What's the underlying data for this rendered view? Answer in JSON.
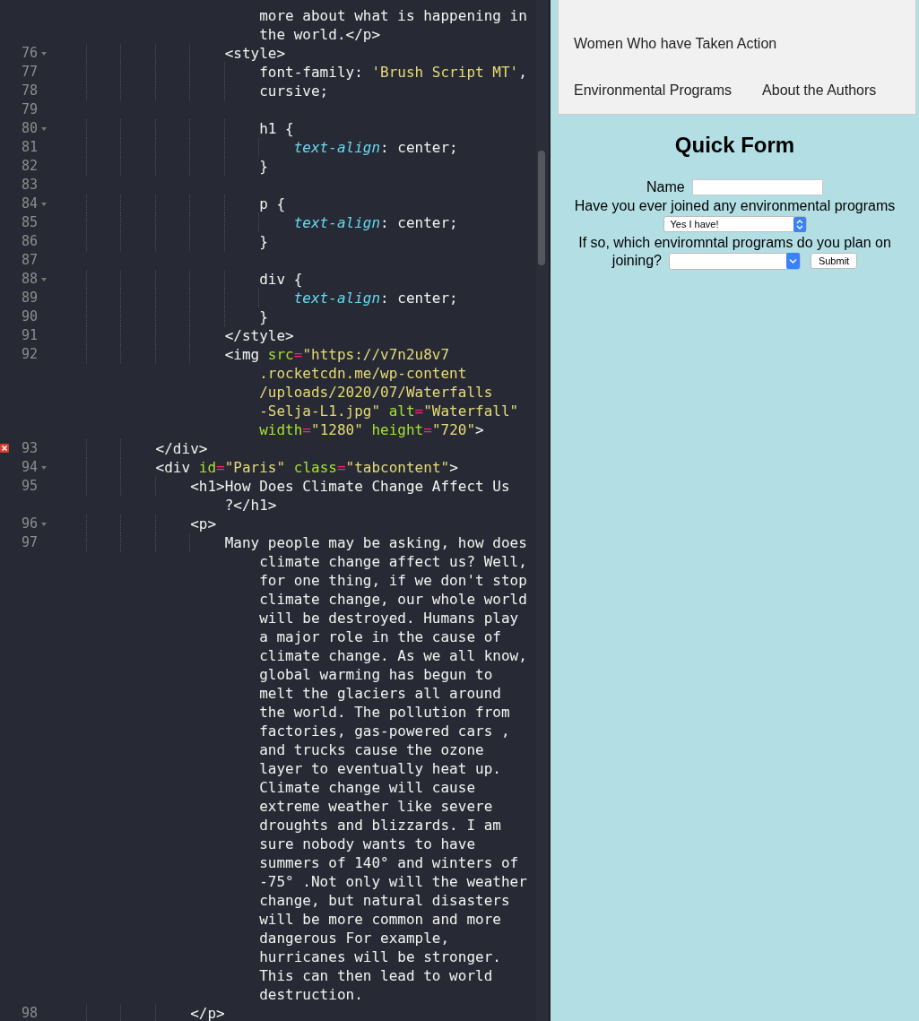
{
  "editor": {
    "lines": [
      {
        "rows": [
          {
            "segments": [
              {
                "kind": "plain",
                "text": "                        more about what is happening in"
              }
            ]
          },
          {
            "segments": [
              {
                "kind": "plain",
                "text": "                        the world.</p>"
              }
            ]
          }
        ]
      },
      {
        "number": "76",
        "fold": true,
        "rows": [
          {
            "segments": [
              {
                "kind": "plain",
                "text": "                    <style>"
              }
            ]
          }
        ]
      },
      {
        "number": "77",
        "rows": [
          {
            "segments": [
              {
                "kind": "plain",
                "text": "                        font-family: "
              },
              {
                "kind": "string",
                "text": "'Brush Script MT'"
              },
              {
                "kind": "plain",
                "text": ","
              }
            ]
          }
        ]
      },
      {
        "number": "78",
        "rows": [
          {
            "segments": [
              {
                "kind": "plain",
                "text": "                        cursive;"
              }
            ]
          }
        ]
      },
      {
        "number": "79"
      },
      {
        "number": "80",
        "fold": true,
        "rows": [
          {
            "segments": [
              {
                "kind": "plain",
                "text": "                        h1 {"
              }
            ]
          }
        ]
      },
      {
        "number": "81",
        "rows": [
          {
            "segments": [
              {
                "kind": "prop",
                "text": "                            text-align"
              },
              {
                "kind": "plain",
                "text": ": center;"
              }
            ]
          }
        ]
      },
      {
        "number": "82",
        "rows": [
          {
            "segments": [
              {
                "kind": "plain",
                "text": "                        }"
              }
            ]
          }
        ]
      },
      {
        "number": "83"
      },
      {
        "number": "84",
        "fold": true,
        "rows": [
          {
            "segments": [
              {
                "kind": "plain",
                "text": "                        p {"
              }
            ]
          }
        ]
      },
      {
        "number": "85",
        "rows": [
          {
            "segments": [
              {
                "kind": "prop",
                "text": "                            text-align"
              },
              {
                "kind": "plain",
                "text": ": center;"
              }
            ]
          }
        ]
      },
      {
        "number": "86",
        "rows": [
          {
            "segments": [
              {
                "kind": "plain",
                "text": "                        }"
              }
            ]
          }
        ]
      },
      {
        "number": "87"
      },
      {
        "number": "88",
        "fold": true,
        "rows": [
          {
            "segments": [
              {
                "kind": "plain",
                "text": "                        div {"
              }
            ]
          }
        ]
      },
      {
        "number": "89",
        "rows": [
          {
            "segments": [
              {
                "kind": "prop",
                "text": "                            text-align"
              },
              {
                "kind": "plain",
                "text": ": center;"
              }
            ]
          }
        ]
      },
      {
        "number": "90",
        "rows": [
          {
            "segments": [
              {
                "kind": "plain",
                "text": "                        }"
              }
            ]
          }
        ]
      },
      {
        "number": "91",
        "rows": [
          {
            "segments": [
              {
                "kind": "plain",
                "text": "                    </style>"
              }
            ]
          }
        ]
      },
      {
        "number": "92",
        "rows": [
          {
            "segments": [
              {
                "kind": "plain",
                "text": "                    <img "
              },
              {
                "kind": "attr",
                "text": "src"
              },
              {
                "kind": "op",
                "text": "="
              },
              {
                "kind": "string",
                "text": "\"https://v7n2u8v7"
              }
            ]
          },
          {
            "segments": [
              {
                "kind": "string",
                "text": "                        .rocketcdn.me/wp-content"
              }
            ]
          },
          {
            "segments": [
              {
                "kind": "string",
                "text": "                        /uploads/2020/07/Waterfalls"
              }
            ]
          },
          {
            "segments": [
              {
                "kind": "string",
                "text": "                        -Selja-L1.jpg\""
              },
              {
                "kind": "attr",
                "text": " alt"
              },
              {
                "kind": "op",
                "text": "="
              },
              {
                "kind": "string",
                "text": "\"Waterfall\""
              }
            ]
          },
          {
            "segments": [
              {
                "kind": "attr",
                "text": "                        width"
              },
              {
                "kind": "op",
                "text": "="
              },
              {
                "kind": "string",
                "text": "\"1280\""
              },
              {
                "kind": "attr",
                "text": " height"
              },
              {
                "kind": "op",
                "text": "="
              },
              {
                "kind": "string",
                "text": "\"720\""
              },
              {
                "kind": "plain",
                "text": ">"
              }
            ]
          }
        ]
      },
      {
        "number": "93",
        "error": true,
        "rows": [
          {
            "segments": [
              {
                "kind": "plain",
                "text": "            </div>"
              }
            ]
          }
        ]
      },
      {
        "number": "94",
        "fold": true,
        "rows": [
          {
            "segments": [
              {
                "kind": "plain",
                "text": "            <div "
              },
              {
                "kind": "attr",
                "text": "id"
              },
              {
                "kind": "op",
                "text": "="
              },
              {
                "kind": "string",
                "text": "\"Paris\""
              },
              {
                "kind": "attr",
                "text": " class"
              },
              {
                "kind": "op",
                "text": "="
              },
              {
                "kind": "string",
                "text": "\"tabcontent\""
              },
              {
                "kind": "plain",
                "text": ">"
              }
            ]
          }
        ]
      },
      {
        "number": "95",
        "rows": [
          {
            "segments": [
              {
                "kind": "plain",
                "text": "                <h1>How Does Climate Change Affect Us"
              }
            ]
          },
          {
            "segments": [
              {
                "kind": "plain",
                "text": "                    ?</h1>"
              }
            ]
          }
        ]
      },
      {
        "number": "96",
        "fold": true,
        "rows": [
          {
            "segments": [
              {
                "kind": "plain",
                "text": "                <p>"
              }
            ]
          }
        ]
      },
      {
        "number": "97",
        "rows": [
          {
            "segments": [
              {
                "kind": "plain",
                "text": "                    Many people may be asking, how does"
              }
            ]
          },
          {
            "segments": [
              {
                "kind": "plain",
                "text": "                        climate change affect us? Well,"
              }
            ]
          },
          {
            "segments": [
              {
                "kind": "plain",
                "text": "                        for one thing, if we don't stop"
              }
            ]
          },
          {
            "segments": [
              {
                "kind": "plain",
                "text": "                        climate change, our whole world"
              }
            ]
          },
          {
            "segments": [
              {
                "kind": "plain",
                "text": "                        will be destroyed. Humans play"
              }
            ]
          },
          {
            "segments": [
              {
                "kind": "plain",
                "text": "                        a major role in the cause of"
              }
            ]
          },
          {
            "segments": [
              {
                "kind": "plain",
                "text": "                        climate change. As we all know,"
              }
            ]
          },
          {
            "segments": [
              {
                "kind": "plain",
                "text": "                        global warming has begun to"
              }
            ]
          },
          {
            "segments": [
              {
                "kind": "plain",
                "text": "                        melt the glaciers all around"
              }
            ]
          },
          {
            "segments": [
              {
                "kind": "plain",
                "text": "                        the world. The pollution from"
              }
            ]
          },
          {
            "segments": [
              {
                "kind": "plain",
                "text": "                        factories, gas-powered cars ,"
              }
            ]
          },
          {
            "segments": [
              {
                "kind": "plain",
                "text": "                        and trucks cause the ozone"
              }
            ]
          },
          {
            "segments": [
              {
                "kind": "plain",
                "text": "                        layer to eventually heat up."
              }
            ]
          },
          {
            "segments": [
              {
                "kind": "plain",
                "text": "                        Climate change will cause"
              }
            ]
          },
          {
            "segments": [
              {
                "kind": "plain",
                "text": "                        extreme weather like severe"
              }
            ]
          },
          {
            "segments": [
              {
                "kind": "plain",
                "text": "                        droughts and blizzards. I am"
              }
            ]
          },
          {
            "segments": [
              {
                "kind": "plain",
                "text": "                        sure nobody wants to have"
              }
            ]
          },
          {
            "segments": [
              {
                "kind": "plain",
                "text": "                        summers of 140° and winters of"
              }
            ]
          },
          {
            "segments": [
              {
                "kind": "plain",
                "text": "                        -75° .Not only will the weather"
              }
            ]
          },
          {
            "segments": [
              {
                "kind": "plain",
                "text": "                        change, but natural disasters"
              }
            ]
          },
          {
            "segments": [
              {
                "kind": "plain",
                "text": "                        will be more common and more"
              }
            ]
          },
          {
            "segments": [
              {
                "kind": "plain",
                "text": "                        dangerous For example,"
              }
            ]
          },
          {
            "segments": [
              {
                "kind": "plain",
                "text": "                        hurricanes will be stronger."
              }
            ]
          },
          {
            "segments": [
              {
                "kind": "plain",
                "text": "                        This can then lead to world"
              }
            ]
          },
          {
            "segments": [
              {
                "kind": "plain",
                "text": "                        destruction."
              }
            ]
          }
        ]
      },
      {
        "number": "98",
        "rows": [
          {
            "segments": [
              {
                "kind": "plain",
                "text": "                </p>"
              }
            ]
          }
        ]
      }
    ]
  },
  "preview": {
    "nav_links": [
      {
        "label": "Women Who have Taken Action"
      },
      {
        "label": "Environmental Programs"
      },
      {
        "label": "About the Authors"
      }
    ],
    "form": {
      "title": "Quick Form",
      "fields": [
        {
          "kind": "text",
          "label_lines": [
            "Name"
          ]
        },
        {
          "kind": "stepper",
          "label_lines": [
            "Have you ever joined any environmental programs"
          ],
          "value": "Yes I have!"
        },
        {
          "kind": "dropdown",
          "label_lines": [
            "If so, which enviromntal programs do you plan on",
            "joining?"
          ]
        }
      ],
      "submit": "Submit"
    }
  }
}
